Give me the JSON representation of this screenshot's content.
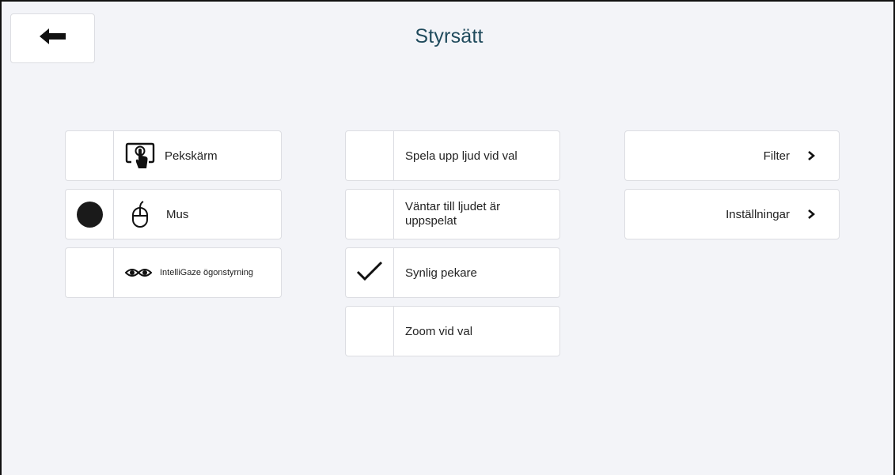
{
  "header": {
    "title": "Styrsätt",
    "back_icon": "arrow-left-icon"
  },
  "input_methods": [
    {
      "label": "Pekskärm",
      "icon": "touchscreen-icon",
      "selected": false
    },
    {
      "label": "Mus",
      "icon": "mouse-icon",
      "selected": true
    },
    {
      "label": "IntelliGaze ögonstyrning",
      "icon": "eye-gaze-icon",
      "selected": false
    }
  ],
  "options": [
    {
      "label": "Spela upp ljud vid val",
      "checked": false
    },
    {
      "label": "Väntar till ljudet är uppspelat",
      "checked": false
    },
    {
      "label": "Synlig pekare",
      "checked": true
    },
    {
      "label": "Zoom vid val",
      "checked": false
    }
  ],
  "navigation": [
    {
      "label": "Filter",
      "icon": "chevron-right-icon"
    },
    {
      "label": "Inställningar",
      "icon": "chevron-right-icon"
    }
  ],
  "colors": {
    "background": "#f3f4f8",
    "title": "#1f4a5c",
    "card": "#ffffff",
    "border": "#dcdde2"
  }
}
